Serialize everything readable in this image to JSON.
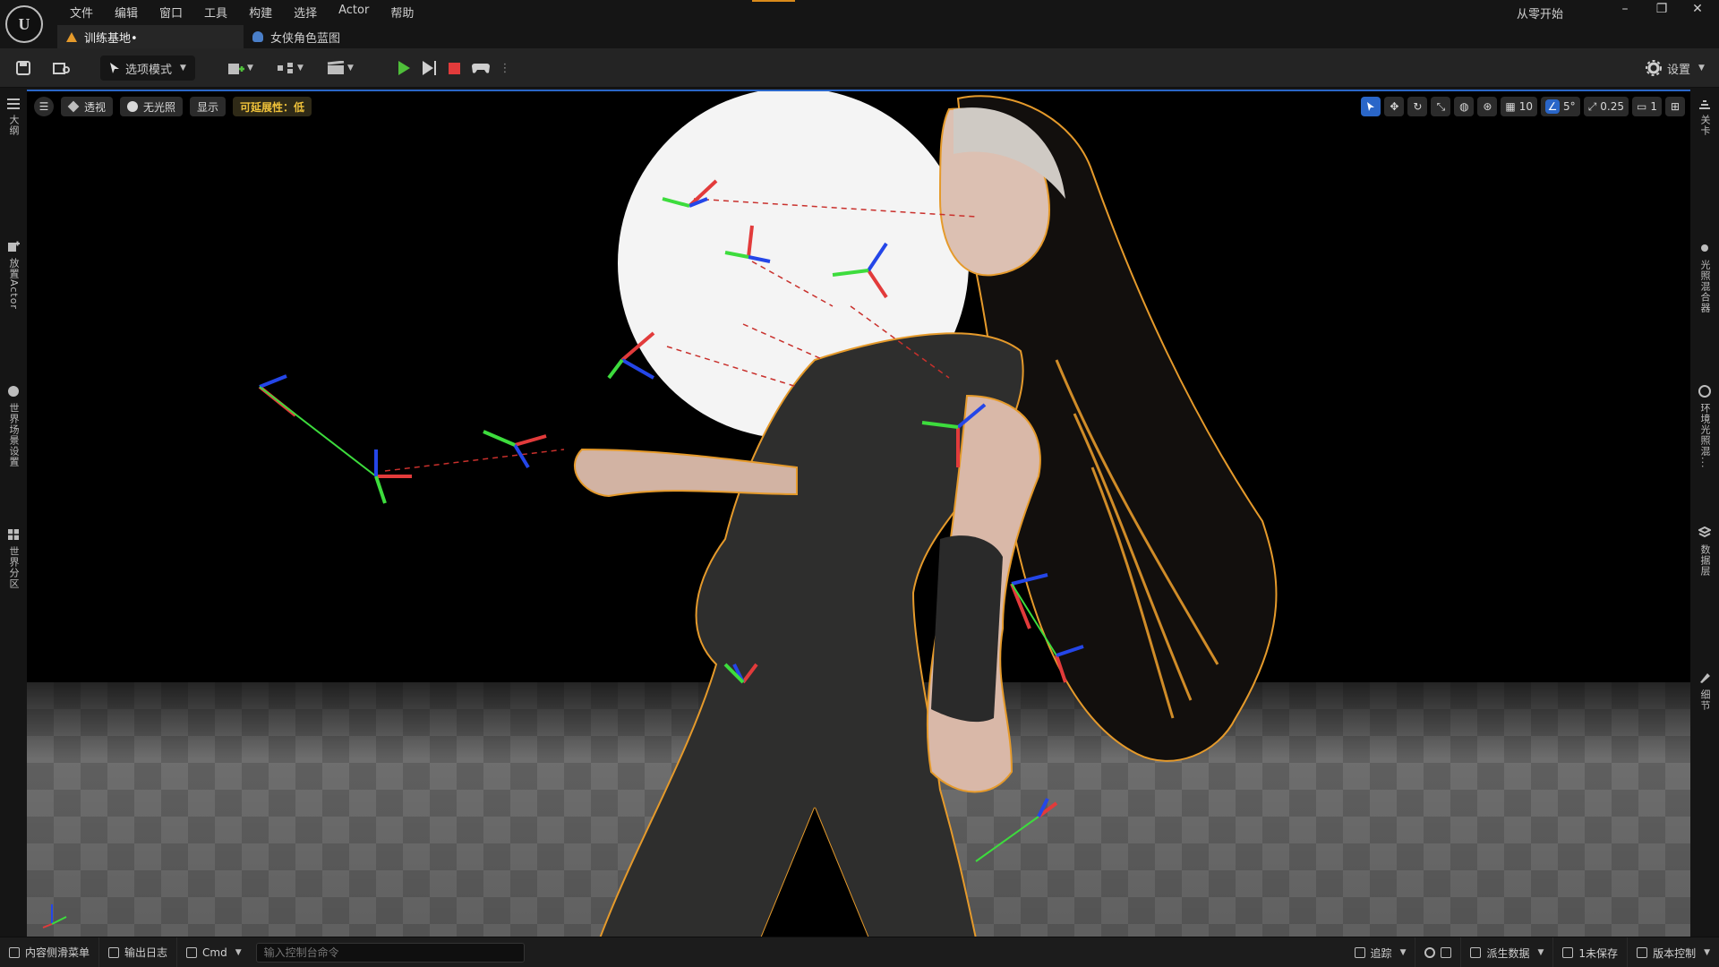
{
  "menu": [
    "文件",
    "编辑",
    "窗口",
    "工具",
    "构建",
    "选择",
    "Actor",
    "帮助"
  ],
  "project_name": "从零开始",
  "window_controls": {
    "minimize": "–",
    "restore": "❐",
    "close": "✕"
  },
  "tabs": [
    {
      "label": "训练基地•",
      "icon": "warning-icon",
      "active": true
    },
    {
      "label": "女侠角色蓝图",
      "icon": "blueprint-icon",
      "active": false
    }
  ],
  "toolbar": {
    "mode_label": "选项模式",
    "settings_label": "设置"
  },
  "left_panels": [
    "大纲",
    "放置Actor",
    "世界场景设置",
    "世界分区"
  ],
  "right_panels": [
    "关卡",
    "光照混合器",
    "环境光照混...",
    "数据层",
    "细节"
  ],
  "viewport": {
    "perspective_label": "透视",
    "lighting_label": "无光照",
    "show_label": "显示",
    "scalability_label": "可延展性：低",
    "grid_snap": "10",
    "rotation_snap": "5°",
    "scale_snap": "0.25",
    "camera_speed": "1"
  },
  "statusbar": {
    "content_drawer": "内容侧滑菜单",
    "output_log": "输出日志",
    "cmd": "Cmd",
    "console_placeholder": "输入控制台命令",
    "trace": "追踪",
    "derived_data": "派生数据",
    "unsaved": "1未保存",
    "source_control": "版本控制"
  },
  "colors": {
    "accent": "#2a66c8",
    "play": "#4fbf3a",
    "stop": "#e23b3b",
    "warn": "#f0c23a",
    "selection": "#e59a2b"
  }
}
